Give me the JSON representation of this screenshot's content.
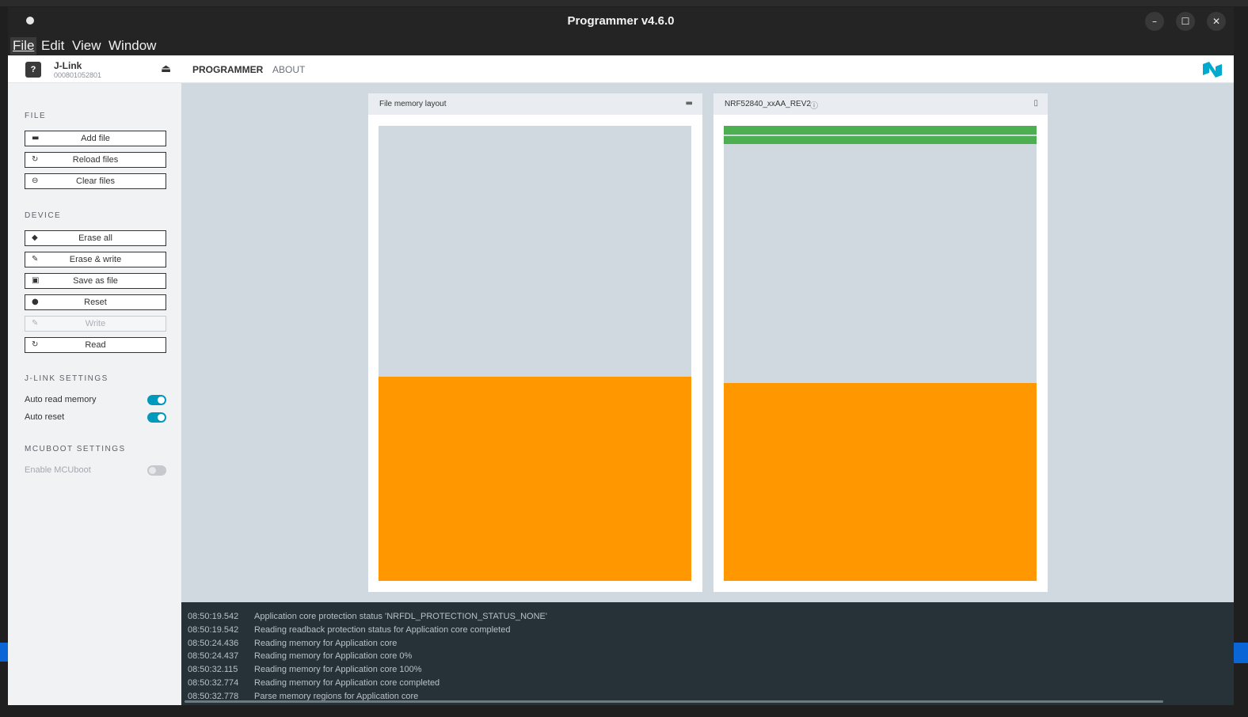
{
  "window": {
    "title": "Programmer v4.6.0"
  },
  "titlebar_buttons": {
    "minimize": "–",
    "maximize": "☐",
    "close": "✕"
  },
  "menu": [
    "File",
    "Edit",
    "View",
    "Window"
  ],
  "device": {
    "name": "J-Link",
    "serial": "000801052801",
    "chip_glyph": "?"
  },
  "nav": {
    "programmer": "PROGRAMMER",
    "about": "ABOUT"
  },
  "sidebar": {
    "file_title": "FILE",
    "file_buttons": {
      "add": "Add file",
      "reload": "Reload files",
      "clear": "Clear files"
    },
    "device_title": "DEVICE",
    "device_buttons": {
      "erase_all": "Erase all",
      "erase_write": "Erase & write",
      "save": "Save as file",
      "reset": "Reset",
      "write": "Write",
      "read": "Read"
    },
    "jlink_title": "J-LINK SETTINGS",
    "auto_read": "Auto read memory",
    "auto_reset": "Auto reset",
    "mcuboot_title": "MCUBOOT SETTINGS",
    "enable_mcuboot": "Enable MCUboot"
  },
  "toggles": {
    "auto_read": true,
    "auto_reset": true,
    "mcuboot": false
  },
  "panels": {
    "file": {
      "title": "File memory layout",
      "icon": "folder-icon"
    },
    "device": {
      "title": "NRF52840_xxAA_REV2",
      "icon": "info-icon"
    }
  },
  "colors": {
    "region_orange": "#ff9800",
    "region_green": "#4caf50",
    "memory_empty": "#d1d9e0",
    "accent": "#0099be"
  },
  "log": [
    {
      "time": "08:50:19.542",
      "msg": "Application core protection status 'NRFDL_PROTECTION_STATUS_NONE'"
    },
    {
      "time": "08:50:19.542",
      "msg": "Reading readback protection status for Application core completed"
    },
    {
      "time": "08:50:24.436",
      "msg": "Reading memory for Application core"
    },
    {
      "time": "08:50:24.437",
      "msg": "Reading memory for Application core 0%"
    },
    {
      "time": "08:50:32.115",
      "msg": "Reading memory for Application core 100%"
    },
    {
      "time": "08:50:32.774",
      "msg": "Reading memory for Application core completed"
    },
    {
      "time": "08:50:32.778",
      "msg": "Parse memory regions for Application core"
    }
  ]
}
